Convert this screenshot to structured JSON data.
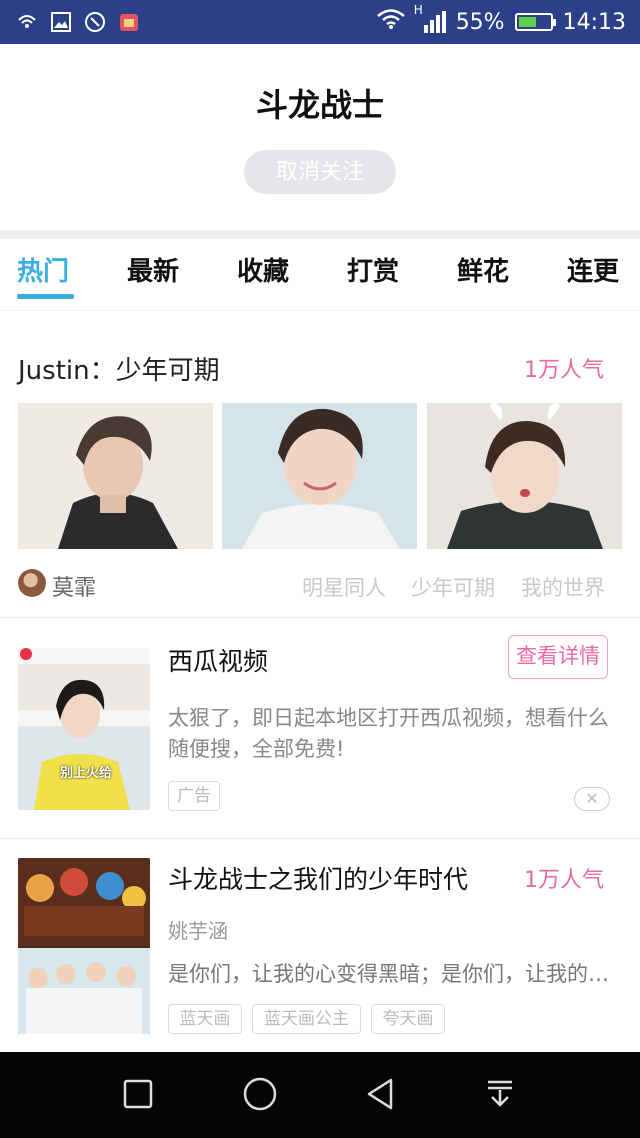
{
  "status_bar": {
    "battery": "55%",
    "time": "14:13",
    "network": "H",
    "battery_level": 0.55,
    "icons": [
      "wifi-hotspot-icon",
      "image-icon",
      "scan-icon",
      "app-icon",
      "wifi-icon",
      "signal-icon",
      "battery-icon"
    ]
  },
  "header": {
    "title": "斗龙战士",
    "unfollow_label": "取消关注"
  },
  "tabs": [
    "热门",
    "最新",
    "收藏",
    "打赏",
    "鲜花",
    "连更"
  ],
  "featured": {
    "title": "Justin：少年可期",
    "popularity": "1万人气",
    "author": "莫霏",
    "tags": [
      "明星同人",
      "少年可期",
      "我的世界"
    ]
  },
  "ad": {
    "title": "西瓜视频",
    "detail_button": "查看详情",
    "description": "太狠了，即日起本地区打开西瓜视频，想看什么随便搜，全部免费!",
    "tag": "广告",
    "thumb_caption": "别上火给"
  },
  "story": {
    "title": "斗龙战士之我们的少年时代",
    "popularity": "1万人气",
    "author": "姚芋涵",
    "description": "是你们，让我的心变得黑暗；是你们，让我的心变得光明",
    "tags": [
      "蓝天画",
      "蓝天画公主",
      "夸天画"
    ]
  },
  "nav": {
    "icons": [
      "recent-apps-icon",
      "home-icon",
      "back-icon",
      "notification-pull-icon"
    ]
  },
  "colors": {
    "status_bar": "#2b4088",
    "accent_blue": "#3aaee0",
    "accent_pink": "#ea6aa4"
  }
}
